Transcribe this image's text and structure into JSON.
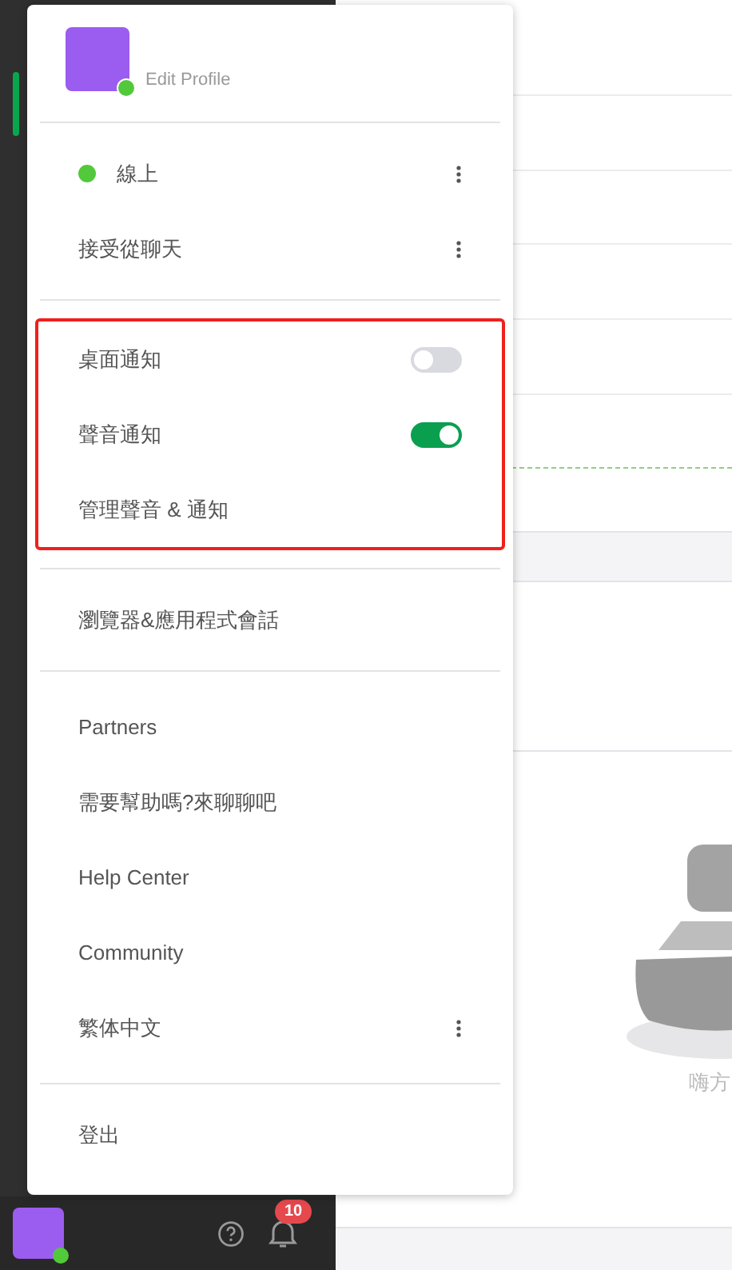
{
  "profile": {
    "link": "Edit Profile",
    "online": true
  },
  "menu_sections": [
    {
      "highlighted": false,
      "items": [
        {
          "kind": "status",
          "label": "線上",
          "color": "#52c93b",
          "more": true
        },
        {
          "kind": "link",
          "label": "接受從聊天",
          "more": true
        }
      ]
    },
    {
      "highlighted": true,
      "items": [
        {
          "kind": "toggle",
          "label": "桌面通知",
          "on": false
        },
        {
          "kind": "toggle",
          "label": "聲音通知",
          "on": true
        },
        {
          "kind": "link",
          "label": "管理聲音 & 通知",
          "more": false
        }
      ]
    },
    {
      "highlighted": false,
      "items": [
        {
          "kind": "link",
          "label": "瀏覽器&應用程式會話",
          "more": false
        }
      ]
    },
    {
      "highlighted": false,
      "items": [
        {
          "kind": "link",
          "label": "Partners",
          "more": false
        },
        {
          "kind": "link",
          "label": "需要幫助嗎?來聊聊吧",
          "more": false
        },
        {
          "kind": "link",
          "label": "Help Center",
          "more": false
        },
        {
          "kind": "link",
          "label": "Community",
          "more": false
        },
        {
          "kind": "link",
          "label": "繁体中文",
          "more": true
        }
      ]
    },
    {
      "highlighted": false,
      "items": [
        {
          "kind": "link",
          "label": "登出",
          "more": false
        }
      ]
    }
  ],
  "bottom_bar": {
    "badge": "10",
    "online": true
  },
  "background": {
    "greeting": "嗨方"
  }
}
